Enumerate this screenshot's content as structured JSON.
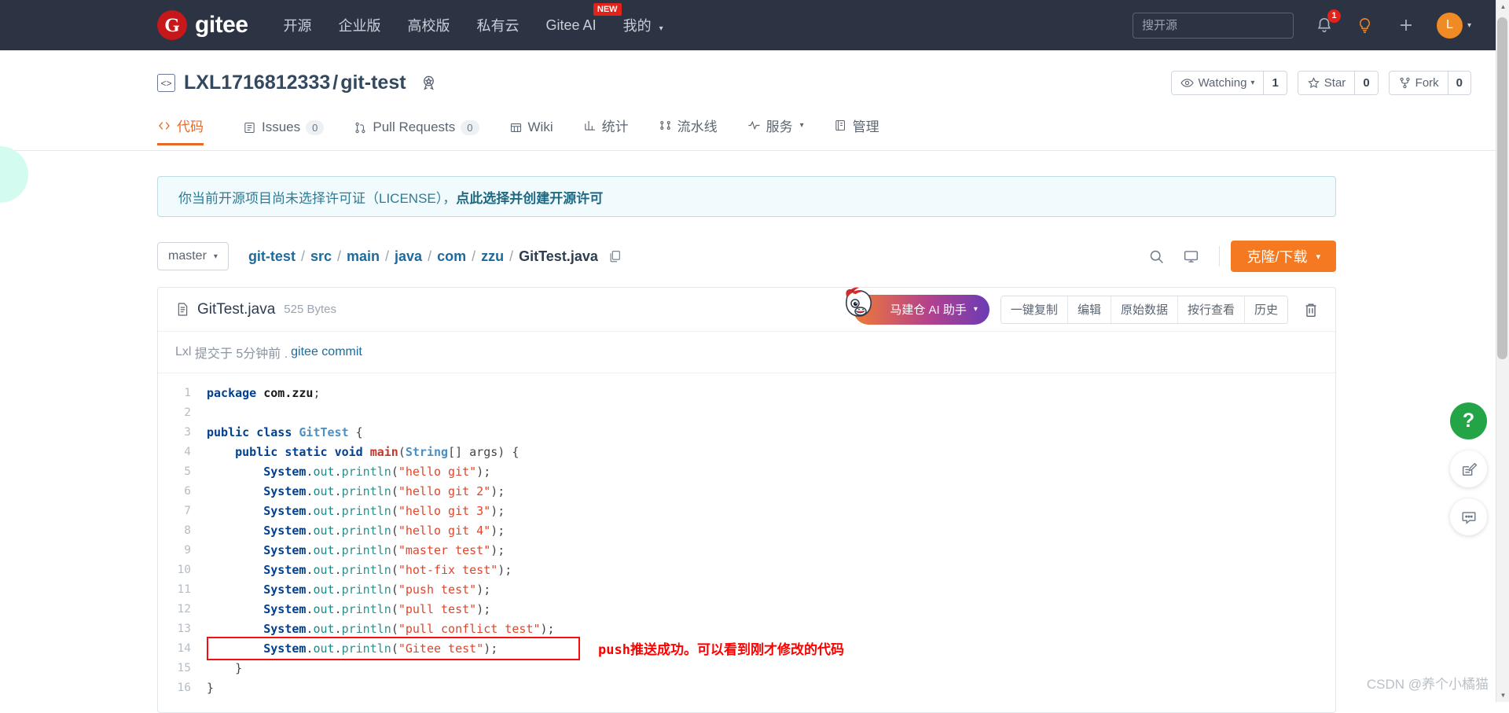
{
  "navbar": {
    "logo_letter": "G",
    "logo_text": "gitee",
    "links": [
      {
        "label": "开源"
      },
      {
        "label": "企业版"
      },
      {
        "label": "高校版"
      },
      {
        "label": "私有云"
      },
      {
        "label": "Gitee AI",
        "badge": "NEW"
      },
      {
        "label": "我的",
        "caret": "▾"
      }
    ],
    "search_placeholder": "搜开源",
    "notification_count": "1",
    "avatar_letter": "L",
    "icons": {
      "bell": "bell-icon",
      "bulb": "lightbulb-icon",
      "plus": "plus-icon"
    }
  },
  "repo": {
    "owner": "LXL1716812333",
    "separator": "/",
    "name": "git-test",
    "actions": [
      {
        "name": "watching",
        "label": "Watching",
        "caret": "▾",
        "count": "1"
      },
      {
        "name": "star",
        "label": "Star",
        "count": "0"
      },
      {
        "name": "fork",
        "label": "Fork",
        "count": "0"
      }
    ],
    "tabs": [
      {
        "id": "code",
        "label": "代码",
        "active": true
      },
      {
        "id": "issues",
        "label": "Issues",
        "pill": "0"
      },
      {
        "id": "pulls",
        "label": "Pull Requests",
        "pill": "0"
      },
      {
        "id": "wiki",
        "label": "Wiki"
      },
      {
        "id": "stats",
        "label": "统计"
      },
      {
        "id": "pipeline",
        "label": "流水线"
      },
      {
        "id": "service",
        "label": "服务",
        "caret": "▾"
      },
      {
        "id": "manage",
        "label": "管理"
      }
    ]
  },
  "license_banner": {
    "text": "你当前开源项目尚未选择许可证（LICENSE），",
    "link": "点此选择并创建开源许可"
  },
  "path_bar": {
    "branch": "master",
    "branch_caret": "▾",
    "crumbs": [
      "git-test",
      "src",
      "main",
      "java",
      "com",
      "zzu"
    ],
    "current": "GitTest.java",
    "separator": "/",
    "clone_label": "克隆/下载",
    "clone_caret": "▾"
  },
  "file": {
    "name": "GitTest.java",
    "size": "525 Bytes",
    "ai_label": "马建仓 AI 助手",
    "ai_caret": "▾",
    "actions": [
      "一键复制",
      "编辑",
      "原始数据",
      "按行查看",
      "历史"
    ],
    "commit_author": "Lxl",
    "commit_time": "提交于 5分钟前 .",
    "commit_message": "gitee commit"
  },
  "code": {
    "lines": [
      {
        "n": "1",
        "t": "package"
      },
      {
        "n": "2",
        "t": "blank"
      },
      {
        "n": "3",
        "t": "class"
      },
      {
        "n": "4",
        "t": "main"
      },
      {
        "n": "5",
        "t": "print",
        "str": "hello git"
      },
      {
        "n": "6",
        "t": "print",
        "str": "hello git 2"
      },
      {
        "n": "7",
        "t": "print",
        "str": "hello git 3"
      },
      {
        "n": "8",
        "t": "print",
        "str": "hello git 4"
      },
      {
        "n": "9",
        "t": "print",
        "str": "master test"
      },
      {
        "n": "10",
        "t": "print",
        "str": "hot-fix test"
      },
      {
        "n": "11",
        "t": "print",
        "str": "push test"
      },
      {
        "n": "12",
        "t": "print",
        "str": "pull test"
      },
      {
        "n": "13",
        "t": "print",
        "str": "pull conflict test"
      },
      {
        "n": "14",
        "t": "print",
        "str": "Gitee test",
        "highlight": true
      },
      {
        "n": "15",
        "t": "closeinner"
      },
      {
        "n": "16",
        "t": "closeouter"
      }
    ],
    "tokens": {
      "package_kw": "package",
      "package_name": "com.zzu",
      "public_kw": "public",
      "class_kw": "class",
      "class_name": "GitTest",
      "static_kw": "static",
      "void_kw": "void",
      "main_name": "main",
      "string_type": "String",
      "args_name": "args",
      "system": "System",
      "out": "out",
      "println": "println"
    }
  },
  "annotation": {
    "text": "push推送成功。可以看到刚才修改的代码"
  },
  "float_buttons": [
    {
      "name": "help-fab",
      "glyph": "?"
    },
    {
      "name": "feedback-fab",
      "glyph": "edit-icon"
    },
    {
      "name": "chat-fab",
      "glyph": "chat-icon"
    }
  ],
  "watermark": "CSDN @养个小橘猫",
  "colors": {
    "navbar_bg": "#2c3343",
    "accent_orange": "#f47920",
    "brand_red": "#c6171b",
    "link_blue": "#1f6a9c",
    "annotation_red": "#ff0000",
    "help_green": "#22a447"
  }
}
